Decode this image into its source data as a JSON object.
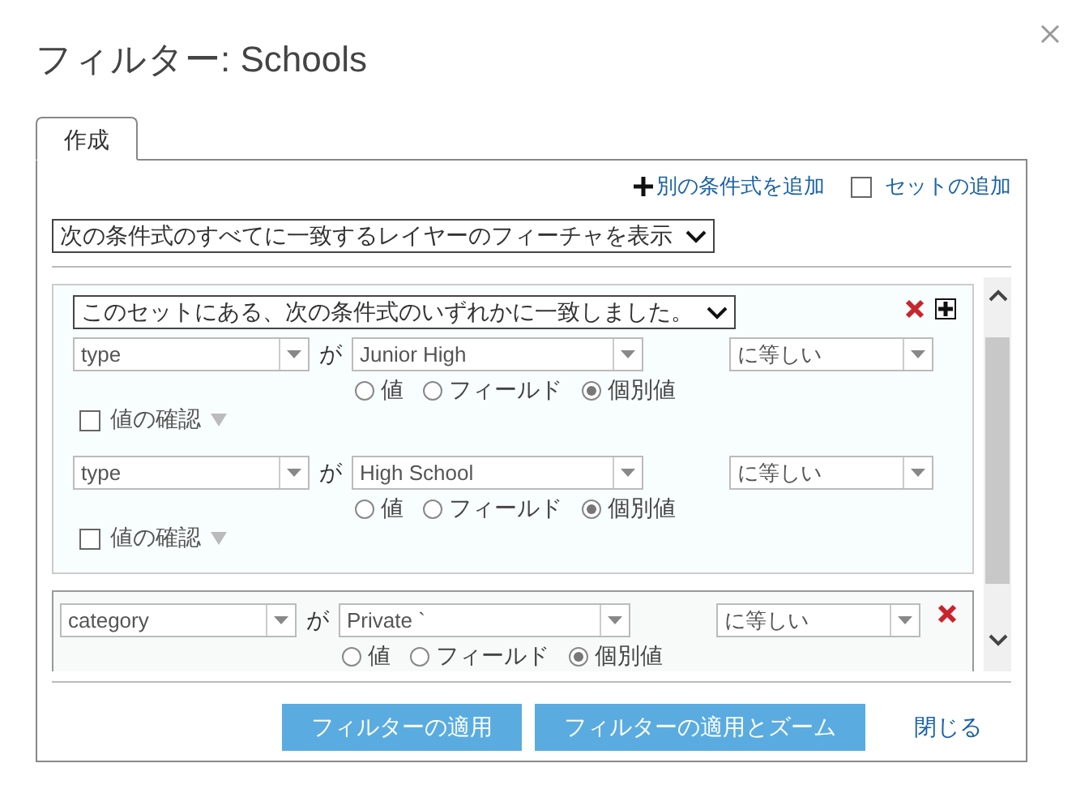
{
  "dialog": {
    "title": "フィルター: Schools"
  },
  "tabs": [
    {
      "label": "作成",
      "selected": true
    }
  ],
  "actions": {
    "add_expression": "別の条件式を追加",
    "add_set": {
      "label": "セットの追加",
      "checked": false
    }
  },
  "match_select": "次の条件式のすべてに一致するレイヤーのフィーチャを表示",
  "items": [
    {
      "kind": "set",
      "match_select": "このセットにある、次の条件式のいずれかに一致しました。",
      "conditions": [
        {
          "field": "type",
          "connector": "が",
          "value": "Junior High",
          "operator": "に等しい",
          "value_types": [
            {
              "label": "値",
              "selected": false
            },
            {
              "label": "フィールド",
              "selected": false
            },
            {
              "label": "個別値",
              "selected": true
            }
          ],
          "verify": {
            "label": "値の確認",
            "checked": false
          }
        },
        {
          "field": "type",
          "connector": "が",
          "value": "High School",
          "operator": "に等しい",
          "value_types": [
            {
              "label": "値",
              "selected": false
            },
            {
              "label": "フィールド",
              "selected": false
            },
            {
              "label": "個別値",
              "selected": true
            }
          ],
          "verify": {
            "label": "値の確認",
            "checked": false
          }
        }
      ]
    },
    {
      "kind": "condition",
      "field": "category",
      "connector": "が",
      "value": "Private `",
      "operator": "に等しい",
      "value_types": [
        {
          "label": "値",
          "selected": false
        },
        {
          "label": "フィールド",
          "selected": false
        },
        {
          "label": "個別値",
          "selected": true
        }
      ]
    }
  ],
  "buttons": [
    "フィルターの適用",
    "フィルターの適用とズーム"
  ],
  "close_link": "閉じる"
}
